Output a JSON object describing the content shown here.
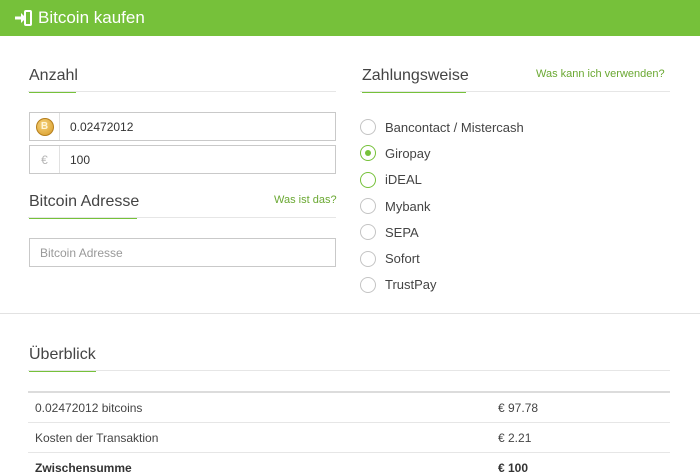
{
  "header": {
    "title": "Bitcoin kaufen",
    "icon": "login-icon"
  },
  "amount": {
    "title": "Anzahl",
    "btc_value": "0.02472012",
    "coin_symbol": "B",
    "currency_symbol": "€",
    "eur_value": "100"
  },
  "address": {
    "title": "Bitcoin Adresse",
    "help_link": "Was ist das?",
    "placeholder": "Bitcoin Adresse"
  },
  "payment": {
    "title": "Zahlungsweise",
    "help_link": "Was kann ich verwenden?",
    "selected": "Giropay",
    "options": [
      "Bancontact / Mistercash",
      "Giropay",
      "iDEAL",
      "Mybank",
      "SEPA",
      "Sofort",
      "TrustPay"
    ]
  },
  "overview": {
    "title": "Überblick",
    "rows": [
      {
        "label": "0.02472012 bitcoins",
        "value": "€ 97.78"
      },
      {
        "label": "Kosten der Transaktion",
        "value": "€ 2.21"
      },
      {
        "label": "Zwischensumme",
        "value": "€ 100"
      }
    ]
  },
  "colors": {
    "accent": "#76c13a",
    "link": "#6aa832"
  }
}
